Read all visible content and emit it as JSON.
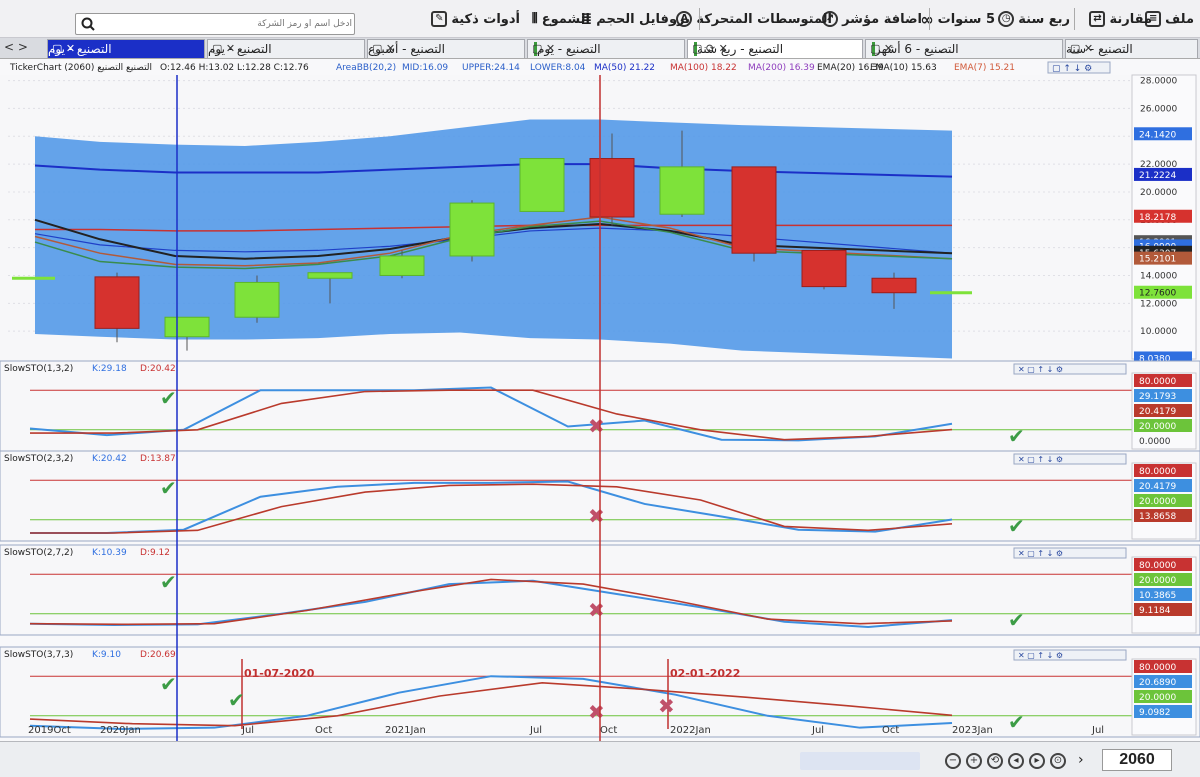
{
  "toolbar": {
    "file": "ملف",
    "compare": "مقارنة",
    "quarter": "ربع سنة",
    "five_years": "5 سنوات",
    "add_indicator": "اضافة مؤشر",
    "moving_averages": "المتوسطات المتحركة",
    "volume_profile": "بروفايل الحجم",
    "candles": "الشموع",
    "smart_tools": "أدوات ذكية",
    "search_placeholder": "ادخل اسم أو رمز الشركة"
  },
  "tabs": [
    {
      "label": "التصنيع - سنة"
    },
    {
      "label": "التصنيع - 6 أشهر"
    },
    {
      "label": "التصنيع - ربع سنة"
    },
    {
      "label": "التصنيع - يوم"
    },
    {
      "label": "التصنيع - أسبوع"
    },
    {
      "label": "التصنيع - يوم"
    },
    {
      "label": "التصنيع - يوم"
    }
  ],
  "main_header": {
    "title": "TickerChart التصنيع التصنيع (2060)",
    "ohlc": "O:12.46  H:13.02  L:12.28  C:12.76",
    "bb": "AreaBB(20,2)",
    "mid": "MID:16.09",
    "upper": "UPPER:24.14",
    "lower": "LOWER:8.04",
    "ma50": "MA(50)  21.22",
    "ma100": "MA(100)  18.22",
    "ma200": "MA(200)  16.39",
    "ema20": "EMA(20)  16.39",
    "ema10": "EMA(10)  15.63",
    "ema7": "EMA(7)  15.21"
  },
  "main_axis": {
    "ticks": [
      "28.0000",
      "26.0000",
      "24.0000",
      "22.0000",
      "20.0000",
      "18.0000",
      "16.0000",
      "14.0000",
      "12.0000",
      "10.0000"
    ],
    "badges": [
      "24.1420",
      "21.2224",
      "18.2178",
      "16.3901",
      "16.0900",
      "15.6307",
      "15.2101",
      "12.7600",
      "8.0380"
    ]
  },
  "stoch": [
    {
      "title": "SlowSTO(1,3,2)",
      "k": "K:29.18",
      "d": "D:20.42",
      "badges": [
        "80.0000",
        "29.1793",
        "20.4179",
        "20.0000",
        "0.0000"
      ]
    },
    {
      "title": "SlowSTO(2,3,2)",
      "k": "K:20.42",
      "d": "D:13.87",
      "badges": [
        "80.0000",
        "20.4179",
        "20.0000",
        "13.8658"
      ]
    },
    {
      "title": "SlowSTO(2,7,2)",
      "k": "K:10.39",
      "d": "D:9.12",
      "badges": [
        "80.0000",
        "20.0000",
        "10.3865",
        "9.1184"
      ]
    },
    {
      "title": "SlowSTO(3,7,3)",
      "k": "K:9.10",
      "d": "D:20.69",
      "badges": [
        "80.0000",
        "20.6890",
        "20.0000",
        "9.0982"
      ]
    }
  ],
  "annotations": {
    "date1": "01-07-2020",
    "date2": "02-01-2022"
  },
  "x_axis": [
    "2019Oct",
    "2020Jan",
    "Jul",
    "Oct",
    "2021Jan",
    "Jul",
    "Oct",
    "2022Jan",
    "Jul",
    "Oct",
    "2023Jan",
    "Jul"
  ],
  "status": {
    "symbol": "2060"
  },
  "chart_data": {
    "type": "candlestick",
    "title": "TickerChart التصنيع التصنيع (2060)",
    "x_labels": [
      "2019Oct",
      "2020Jan",
      "Jul",
      "Oct",
      "2021Jan",
      "Jul",
      "Oct",
      "2022Jan",
      "Jul",
      "Oct",
      "2023Jan",
      "Jul"
    ],
    "candles": [
      {
        "o": 13.9,
        "h": 14.2,
        "l": 9.2,
        "c": 10.2,
        "color": "red"
      },
      {
        "o": 9.6,
        "h": 11.0,
        "l": 8.6,
        "c": 11.0,
        "color": "green"
      },
      {
        "o": 11.0,
        "h": 14.0,
        "l": 10.6,
        "c": 13.5,
        "color": "green"
      },
      {
        "o": 13.8,
        "h": 14.2,
        "l": 12.0,
        "c": 14.2,
        "color": "green"
      },
      {
        "o": 14.0,
        "h": 15.8,
        "l": 13.8,
        "c": 15.4,
        "color": "green"
      },
      {
        "o": 15.4,
        "h": 19.4,
        "l": 15.0,
        "c": 19.2,
        "color": "green"
      },
      {
        "o": 18.6,
        "h": 22.4,
        "l": 18.6,
        "c": 22.4,
        "color": "green"
      },
      {
        "o": 22.4,
        "h": 24.2,
        "l": 17.6,
        "c": 18.2,
        "color": "red"
      },
      {
        "o": 18.4,
        "h": 24.4,
        "l": 18.2,
        "c": 21.8,
        "color": "green"
      },
      {
        "o": 21.8,
        "h": 21.8,
        "l": 15.0,
        "c": 15.6,
        "color": "red"
      },
      {
        "o": 15.8,
        "h": 15.8,
        "l": 13.0,
        "c": 13.2,
        "color": "red"
      },
      {
        "o": 13.8,
        "h": 14.2,
        "l": 11.6,
        "c": 12.76,
        "color": "red"
      }
    ],
    "upper_band": [
      24.0,
      23.6,
      23.4,
      23.3,
      23.6,
      24.0,
      24.6,
      25.2,
      25.2,
      25.0,
      24.8,
      24.4
    ],
    "lower_band": [
      9.8,
      9.6,
      9.4,
      9.4,
      9.5,
      9.8,
      9.9,
      9.5,
      9.4,
      9.1,
      8.6,
      8.04
    ],
    "stoch_k": [
      [
        22,
        12,
        20,
        80,
        80,
        80,
        84,
        25,
        34,
        5,
        4,
        10,
        29.18
      ],
      [
        0,
        0,
        5,
        55,
        70,
        76,
        76,
        78,
        44,
        25,
        5,
        2,
        20.42
      ],
      [
        5,
        3,
        4,
        20,
        38,
        65,
        70,
        50,
        30,
        8,
        0,
        10.39
      ],
      [
        5,
        0,
        2,
        20,
        55,
        80,
        76,
        52,
        20,
        2,
        9.1
      ]
    ],
    "stoch_d": [
      [
        15,
        15,
        20,
        60,
        78,
        80,
        80,
        44,
        20,
        5,
        10,
        20.42
      ],
      [
        0,
        0,
        4,
        40,
        62,
        72,
        74,
        70,
        50,
        10,
        4,
        13.87
      ],
      [
        5,
        4,
        5,
        25,
        50,
        72,
        65,
        40,
        12,
        5,
        9.12
      ],
      [
        15,
        8,
        5,
        20,
        50,
        70,
        60,
        48,
        35,
        20.69
      ]
    ],
    "bullish_cross_month": "2020Jan",
    "bearish_cross_month": "Oct 2021"
  }
}
